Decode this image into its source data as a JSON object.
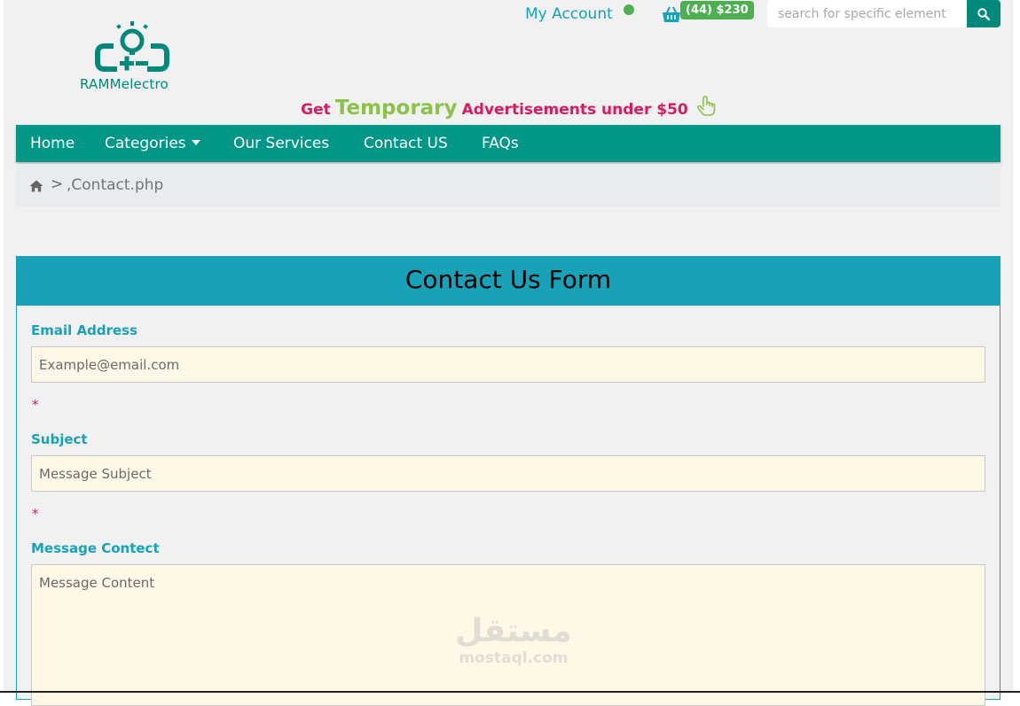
{
  "header": {
    "account_label": "My Account",
    "cart_badge": "(44) $230",
    "search_placeholder": "search for specific element"
  },
  "logo": {
    "text": "RAMMelectro"
  },
  "promo": {
    "get": "Get",
    "highlight": "Temporary",
    "rest": "Advertisements under $50"
  },
  "nav": {
    "items": [
      {
        "label": "Home"
      },
      {
        "label": "Categories"
      },
      {
        "label": "Our Services"
      },
      {
        "label": "Contact US"
      },
      {
        "label": "FAQs"
      }
    ]
  },
  "breadcrumb": {
    "separator": ">",
    "current": ",Contact.php"
  },
  "form": {
    "title": "Contact Us Form",
    "email_label": "Email Address",
    "email_placeholder": "Example@email.com",
    "subject_label": "Subject",
    "subject_placeholder": "Message Subject",
    "message_label": "Message Contect",
    "message_placeholder": "Message Content",
    "required_mark": "*"
  },
  "watermark": {
    "arabic": "مستقل",
    "latin": "mostaql.com"
  },
  "colors": {
    "primary": "#009688",
    "accent": "#17a2b8",
    "promo_pink": "#d81b60",
    "promo_green": "#8bc34a",
    "badge_green": "#4caf50",
    "input_bg": "#fff8e6"
  },
  "icons": [
    "cart-icon",
    "search-icon",
    "home-icon",
    "hand-pointer-icon",
    "logo-icon",
    "caret-down-icon"
  ]
}
